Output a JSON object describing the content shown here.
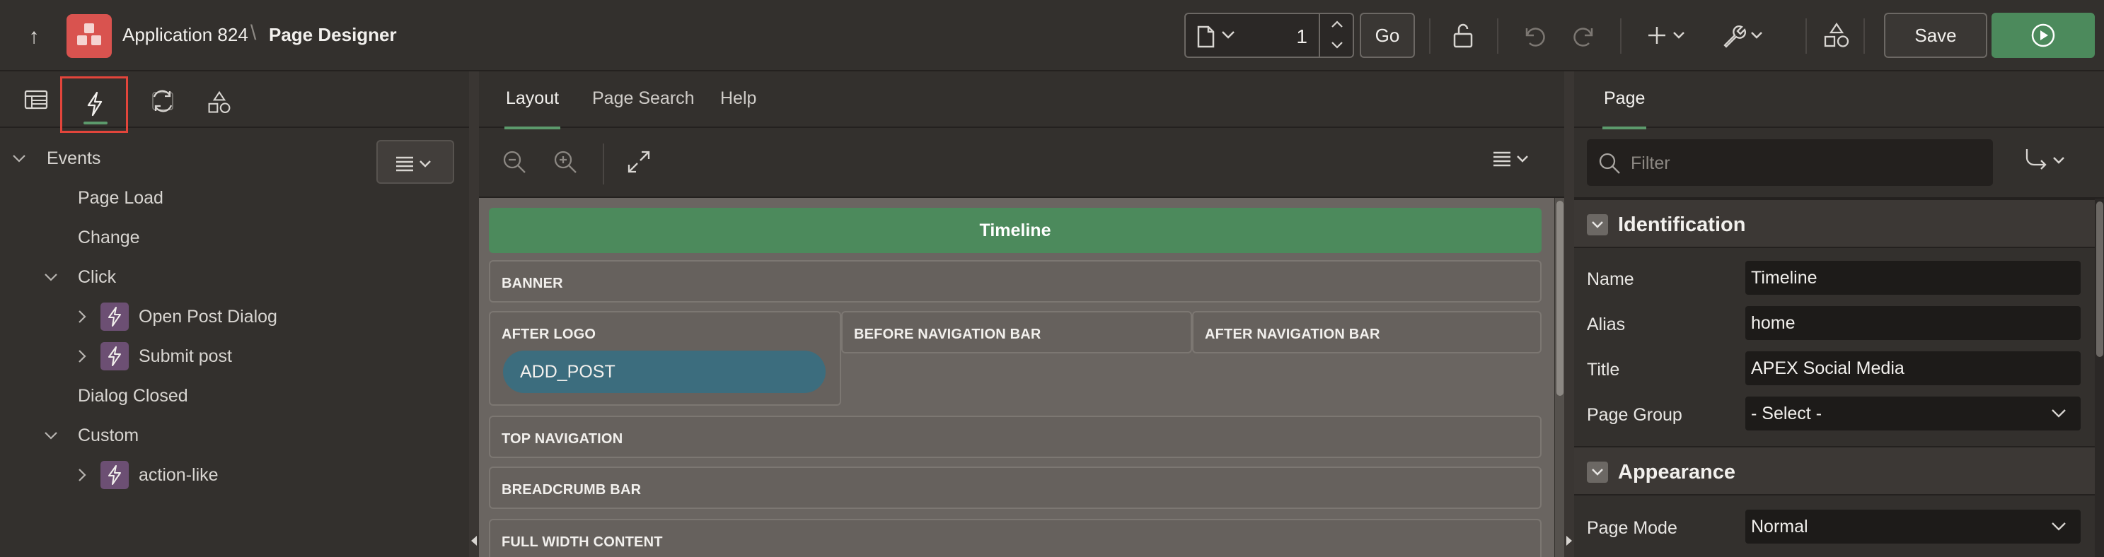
{
  "header": {
    "app_name": "Application 824",
    "separator": "\\",
    "page_title": "Page Designer",
    "page_number": "1",
    "go_label": "Go",
    "save_label": "Save"
  },
  "left": {
    "tree_root": "Events",
    "items": [
      {
        "label": "Page Load"
      },
      {
        "label": "Change"
      },
      {
        "label": "Click"
      },
      {
        "label": "Open Post Dialog"
      },
      {
        "label": "Submit post"
      },
      {
        "label": "Dialog Closed"
      },
      {
        "label": "Custom"
      },
      {
        "label": "action-like"
      }
    ]
  },
  "middle": {
    "tabs": [
      "Layout",
      "Page Search",
      "Help"
    ],
    "page_region_title": "Timeline",
    "regions": {
      "banner": "BANNER",
      "after_logo": "AFTER LOGO",
      "before_nav": "BEFORE NAVIGATION BAR",
      "after_nav": "AFTER NAVIGATION BAR",
      "top_nav": "TOP NAVIGATION",
      "breadcrumb": "BREADCRUMB BAR",
      "full_width": "FULL WIDTH CONTENT"
    },
    "button_add_post": "ADD_POST"
  },
  "right": {
    "tab": "Page",
    "filter_placeholder": "Filter",
    "identification": {
      "title": "Identification",
      "name_label": "Name",
      "name_value": "Timeline",
      "alias_label": "Alias",
      "alias_value": "home",
      "title_label": "Title",
      "title_value": "APEX Social Media",
      "group_label": "Page Group",
      "group_value": "- Select -"
    },
    "appearance": {
      "title": "Appearance",
      "mode_label": "Page Mode",
      "mode_value": "Normal"
    }
  },
  "colors": {
    "accent_green": "#4c8a5c",
    "app_icon_red": "#d9534f",
    "button_teal": "#3c6d7e",
    "dynamic_action_purple": "#6c4f73",
    "highlight_red": "#e2453b"
  }
}
